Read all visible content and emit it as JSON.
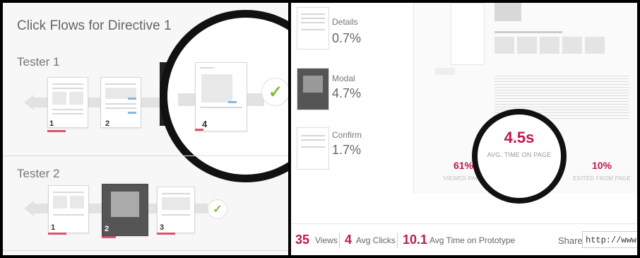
{
  "left": {
    "title": "Click Flows for Directive 1",
    "testers": [
      {
        "label": "Tester 1",
        "steps": [
          "1",
          "2",
          "4"
        ]
      },
      {
        "label": "Tester 2",
        "steps": [
          "1",
          "2",
          "3"
        ]
      }
    ],
    "icons": {
      "success": "checkmark-icon",
      "back": "arrow-left-icon"
    }
  },
  "right": {
    "pages": [
      {
        "name": "Details",
        "percent": "0.7%"
      },
      {
        "name": "Modal",
        "percent": "4.7%"
      },
      {
        "name": "Confirm",
        "percent": "1.7%"
      }
    ],
    "stats": [
      {
        "value": "61%",
        "label": "VIEWED PAGE"
      },
      {
        "value": "4.5s",
        "label": "AVG. TIME ON PAGE"
      },
      {
        "value": "10%",
        "label": "EXITED FROM PAGE"
      }
    ],
    "footer": {
      "views_value": "35",
      "views_label": "Views",
      "clicks_value": "4",
      "clicks_label": "Avg Clicks",
      "time_value": "10.1",
      "time_label": "Avg Time on Prototype",
      "share_label": "Share",
      "share_url": "http://www.so"
    },
    "colors": {
      "accent": "#c2184a",
      "check": "#7cbf3a"
    }
  }
}
